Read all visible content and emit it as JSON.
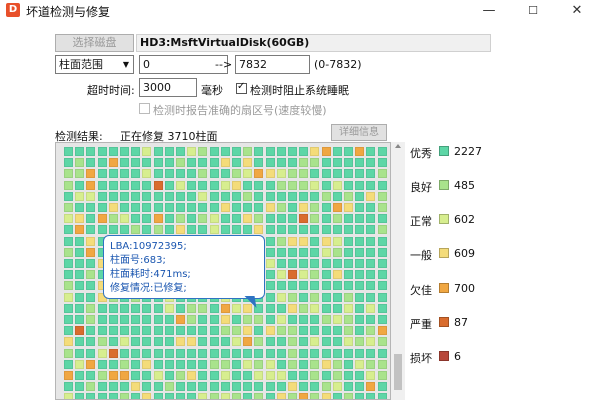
{
  "window": {
    "title": "坏道检测与修复",
    "minimize": "—",
    "maximize": "☐",
    "close": "✕"
  },
  "toolbar": {
    "select_disk_label": "选择磁盘",
    "disk_name": "HD3:MsftVirtualDisk(60GB)"
  },
  "range": {
    "mode": "柱面范围",
    "from": "0",
    "arrow": "-->",
    "to": "7832",
    "hint": "(0-7832)"
  },
  "timeout": {
    "label": "超时时间:",
    "value": "3000",
    "unit": "毫秒"
  },
  "options": {
    "prevent_sleep": "检测时阻止系统睡眠",
    "report_sector": "检测时报告准确的扇区号(速度较慢)"
  },
  "status": {
    "label": "检测结果:",
    "text": "正在修复 3710柱面",
    "details_button": "详细信息"
  },
  "tooltip": {
    "line1": "LBA:10972395;",
    "line2": "柱面号:683;",
    "line3": "柱面耗时:471ms;",
    "line4": "修复情况:已修复;"
  },
  "legend": [
    {
      "name": "优秀",
      "count": "2227",
      "color": "#5dd6a6"
    },
    {
      "name": "良好",
      "count": "485",
      "color": "#a9e38c"
    },
    {
      "name": "正常",
      "count": "602",
      "color": "#d7ee8f"
    },
    {
      "name": "一般",
      "count": "609",
      "color": "#f4dc7a"
    },
    {
      "name": "欠佳",
      "count": "700",
      "color": "#f0a742"
    },
    {
      "name": "严重",
      "count": "87",
      "color": "#d96c2e"
    },
    {
      "name": "损坏",
      "count": "6",
      "color": "#b8473a"
    }
  ]
}
